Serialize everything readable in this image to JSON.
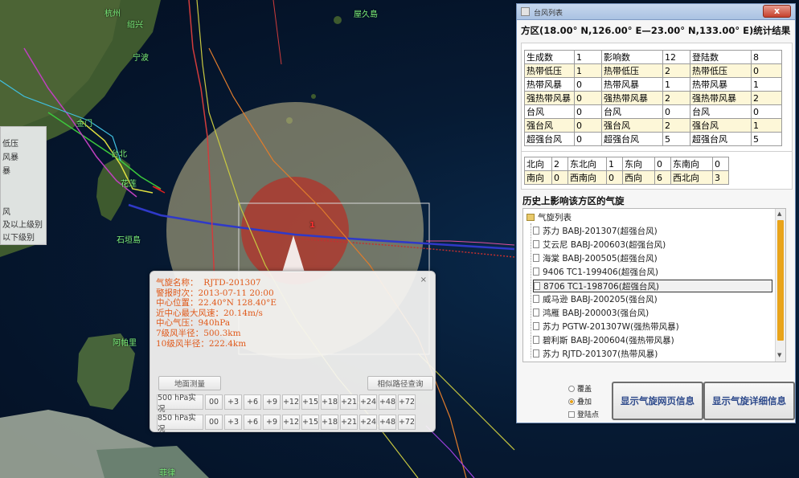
{
  "map": {
    "labels": {
      "hangzhou": "杭州",
      "shaoxing": "绍兴",
      "ningbo": "宁波",
      "yakushima": "屋久島",
      "taibei": "台北",
      "huali": "花莲",
      "jinmen": "金门",
      "ishigaki": "石垣島",
      "luzon": "阿帕里",
      "bottom": "菲律",
      "marker": "1"
    },
    "legend": [
      "低压",
      "风暴",
      "暴",
      "",
      "",
      "风",
      "及以上级别",
      "以下级别"
    ]
  },
  "popup": {
    "close": "×",
    "fields": [
      {
        "k": "气旋名称：",
        "v": "RJTD-201307"
      },
      {
        "k": "警报时次：",
        "v": "2013-07-11 20:00"
      },
      {
        "k": "中心位置：",
        "v": "22.40°N 128.40°E"
      },
      {
        "k": "近中心最大风速：",
        "v": "20.14m/s"
      },
      {
        "k": "中心气压：",
        "v": "940hPa"
      },
      {
        "k": "7级风半径：",
        "v": "500.3km"
      },
      {
        "k": "10级风半径：",
        "v": "222.4km"
      }
    ],
    "btn_left": "地面测量",
    "btn_right": "相似路径查询",
    "rows": [
      {
        "label": "500 hPa实况",
        "cells": [
          "00",
          "+3",
          "+6",
          "+9",
          "+12",
          "+15",
          "+18",
          "+21",
          "+24",
          "+48",
          "+72"
        ]
      },
      {
        "label": "850 hPa实况",
        "cells": [
          "00",
          "+3",
          "+6",
          "+9",
          "+12",
          "+15",
          "+18",
          "+21",
          "+24",
          "+48",
          "+72"
        ]
      }
    ]
  },
  "window": {
    "title": "台风列表",
    "close": "x",
    "region_title": "方区(18.00° N,126.00° E—23.00° N,133.00° E)统计结果",
    "stats": [
      [
        "生成数",
        "1",
        "影响数",
        "12",
        "登陆数",
        "8"
      ],
      [
        "热带低压",
        "1",
        "热带低压",
        "2",
        "热带低压",
        "0"
      ],
      [
        "热带风暴",
        "0",
        "热带风暴",
        "1",
        "热带风暴",
        "1"
      ],
      [
        "强热带风暴",
        "0",
        "强热带风暴",
        "2",
        "强热带风暴",
        "2"
      ],
      [
        "台风",
        "0",
        "台风",
        "0",
        "台风",
        "0"
      ],
      [
        "强台风",
        "0",
        "强台风",
        "2",
        "强台风",
        "1"
      ],
      [
        "超强台风",
        "0",
        "超强台风",
        "5",
        "超强台风",
        "5"
      ]
    ],
    "directions": [
      [
        "北向",
        "2",
        "东北向",
        "1",
        "东向",
        "0",
        "东南向",
        "0"
      ],
      [
        "南向",
        "0",
        "西南向",
        "0",
        "西向",
        "6",
        "西北向",
        "3"
      ]
    ],
    "history_title": "历史上影响该方区的气旋",
    "tree_root": "气旋列表",
    "tree_items": [
      "苏力 BABJ-201307(超强台风)",
      "艾云尼 BABJ-200603(超强台风)",
      "海棠 BABJ-200505(超强台风)",
      "9406 TC1-199406(超强台风)",
      "8706 TC1-198706(超强台风)",
      "威马逊 BABJ-200205(强台风)",
      "鸿雁 BABJ-200003(强台风)",
      "苏力 PGTW-201307W(强热带风暴)",
      "碧利斯 BABJ-200604(强热带风暴)",
      "苏力 RJTD-201307(热带风暴)"
    ],
    "selected_index": 4,
    "options": [
      "覆盖",
      "叠加",
      "登陆点"
    ],
    "btn_web": "显示气旋网页信息",
    "btn_detail": "显示气旋详细信息"
  }
}
